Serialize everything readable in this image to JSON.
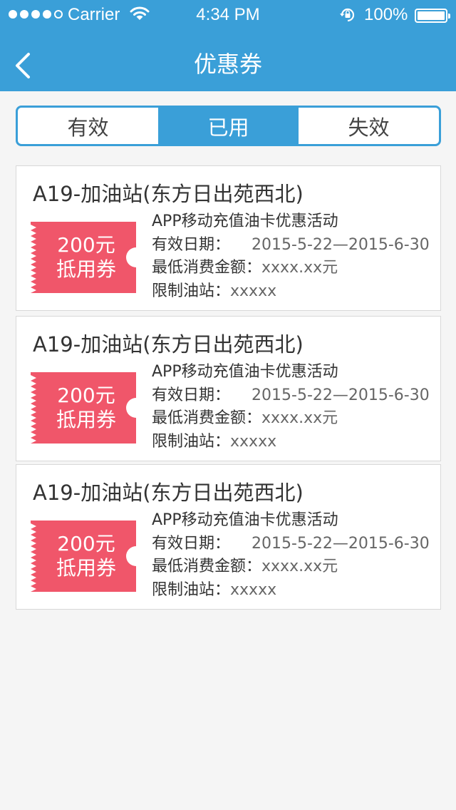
{
  "status_bar": {
    "carrier": "Carrier",
    "time": "4:34 PM",
    "battery": "100%"
  },
  "nav": {
    "title": "优惠券"
  },
  "tabs": [
    {
      "label": "有效",
      "active": false
    },
    {
      "label": "已用",
      "active": true
    },
    {
      "label": "失效",
      "active": false
    }
  ],
  "colors": {
    "primary": "#3a9fd8",
    "ticket": "#f0566a"
  },
  "coupons": [
    {
      "station": "A19-加油站(东方日出苑西北)",
      "amount": "200元",
      "type": "抵用券",
      "activity": "APP移动充值油卡优惠活动",
      "valid_label": "有效日期：",
      "valid_range": "2015-5-22—2015-6-30",
      "min_label": "最低消费金额：",
      "min_value": "xxxx.xx元",
      "limit_label": "限制油站：",
      "limit_value": "xxxxx"
    },
    {
      "station": "A19-加油站(东方日出苑西北)",
      "amount": "200元",
      "type": "抵用券",
      "activity": "APP移动充值油卡优惠活动",
      "valid_label": "有效日期：",
      "valid_range": "2015-5-22—2015-6-30",
      "min_label": "最低消费金额：",
      "min_value": "xxxx.xx元",
      "limit_label": "限制油站：",
      "limit_value": "xxxxx"
    },
    {
      "station": "A19-加油站(东方日出苑西北)",
      "amount": "200元",
      "type": "抵用券",
      "activity": "APP移动充值油卡优惠活动",
      "valid_label": "有效日期：",
      "valid_range": "2015-5-22—2015-6-30",
      "min_label": "最低消费金额：",
      "min_value": "xxxx.xx元",
      "limit_label": "限制油站：",
      "limit_value": "xxxxx"
    }
  ]
}
